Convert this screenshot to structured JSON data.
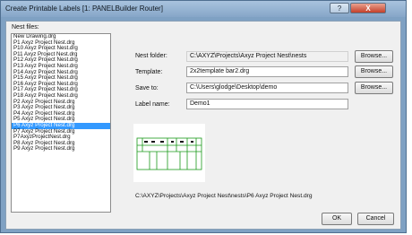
{
  "window": {
    "title": "Create Printable Labels [1: PANELBuilder Router]",
    "help_label": "?",
    "close_label": "X"
  },
  "nest_files": {
    "label": "Nest files:",
    "items": [
      "New Drawing.drg",
      "P1 Axyz Project Nest.drg",
      "P10 Axyz Project Nest.drg",
      "P11 Axyz Project Nest.drg",
      "P12 Axyz Project Nest.drg",
      "P13 Axyz Project Nest.drg",
      "P14 Axyz Project Nest.drg",
      "P15 Axyz Project Nest.drg",
      "P16 Axyz Project Nest.drg",
      "P17 Axyz Project Nest.drg",
      "P18 Axyz Project Nest.drg",
      "P2 Axyz Project Nest.drg",
      "P3 Axyz Project Nest.drg",
      "P4 Axyz Project Nest.drg",
      "P5 Axyz Project Nest.drg",
      "P6 Axyz Project Nest.drg",
      "P7 Axyz Project Nest.drg",
      "P7AxyzProjectNest.drg",
      "P8 Axyz Project Nest.drg",
      "P9 Axyz Project Nest.drg"
    ],
    "selected": "P6 Axyz Project Nest.drg"
  },
  "form": {
    "nest_folder_label": "Nest folder:",
    "nest_folder_value": "C:\\AXYZ\\Projects\\Axyz Project Nest\\nests",
    "template_label": "Template:",
    "template_value": "2x2template bar2.drg",
    "save_to_label": "Save to:",
    "save_to_value": "C:\\Users\\glodge\\Desktop\\demo",
    "label_name_label": "Label name:",
    "label_name_value": "Demo1",
    "browse_label": "Browse..."
  },
  "preview": {
    "path": "C:\\AXYZ\\Projects\\Axyz Project Nest\\nests\\P6 Axyz Project Nest.drg"
  },
  "buttons": {
    "ok": "OK",
    "cancel": "Cancel"
  },
  "colors": {
    "selection": "#3399ff",
    "preview_lines": "#1a9a1a",
    "close_button": "#c4402a"
  }
}
